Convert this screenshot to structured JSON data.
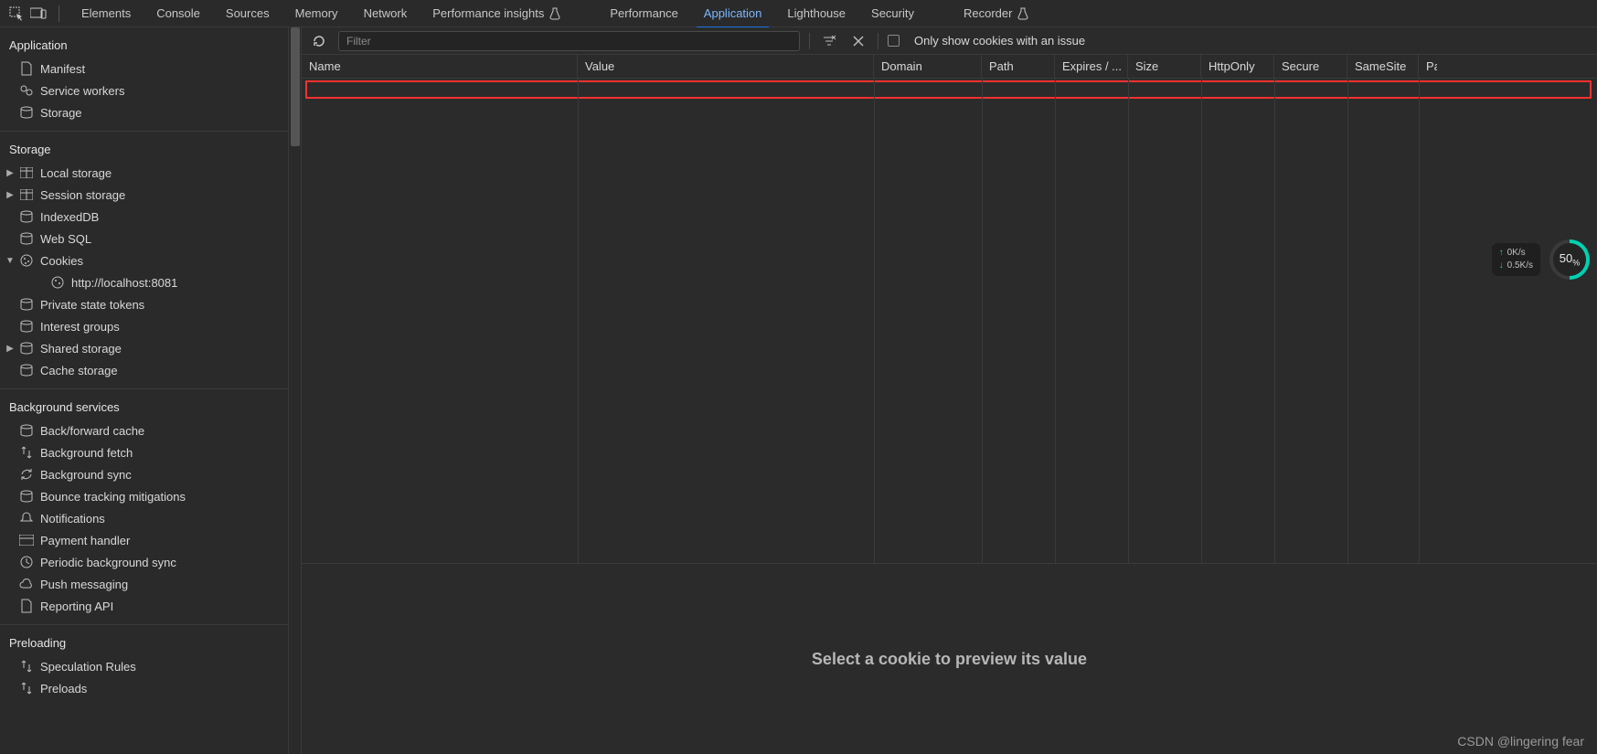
{
  "tabs": {
    "elements": "Elements",
    "console": "Console",
    "sources": "Sources",
    "memory": "Memory",
    "network": "Network",
    "perf_insights": "Performance insights",
    "performance": "Performance",
    "application": "Application",
    "lighthouse": "Lighthouse",
    "security": "Security",
    "recorder": "Recorder"
  },
  "toolbar": {
    "filter_placeholder": "Filter",
    "only_issue_label": "Only show cookies with an issue"
  },
  "columns": {
    "name": "Name",
    "value": "Value",
    "domain": "Domain",
    "path": "Path",
    "expires": "Expires / ...",
    "size": "Size",
    "httponly": "HttpOnly",
    "secure": "Secure",
    "samesite": "SameSite",
    "pa": "Pa"
  },
  "sidebar": {
    "application": {
      "head": "Application",
      "manifest": "Manifest",
      "service_workers": "Service workers",
      "storage": "Storage"
    },
    "storage": {
      "head": "Storage",
      "local_storage": "Local storage",
      "session_storage": "Session storage",
      "indexeddb": "IndexedDB",
      "websql": "Web SQL",
      "cookies": "Cookies",
      "cookies_origin": "http://localhost:8081",
      "private_state_tokens": "Private state tokens",
      "interest_groups": "Interest groups",
      "shared_storage": "Shared storage",
      "cache_storage": "Cache storage"
    },
    "bgservices": {
      "head": "Background services",
      "back_forward_cache": "Back/forward cache",
      "background_fetch": "Background fetch",
      "background_sync": "Background sync",
      "bounce": "Bounce tracking mitigations",
      "notifications": "Notifications",
      "payment": "Payment handler",
      "periodic": "Periodic background sync",
      "push": "Push messaging",
      "reporting": "Reporting API"
    },
    "preloading": {
      "head": "Preloading",
      "speculation": "Speculation Rules",
      "preloads": "Preloads"
    }
  },
  "preview_text": "Select a cookie to preview its value",
  "overlay": {
    "up": "0K/s",
    "down": "0.5K/s",
    "pct": "50",
    "pct_suffix": "%"
  },
  "watermark": "CSDN @lingering fear"
}
